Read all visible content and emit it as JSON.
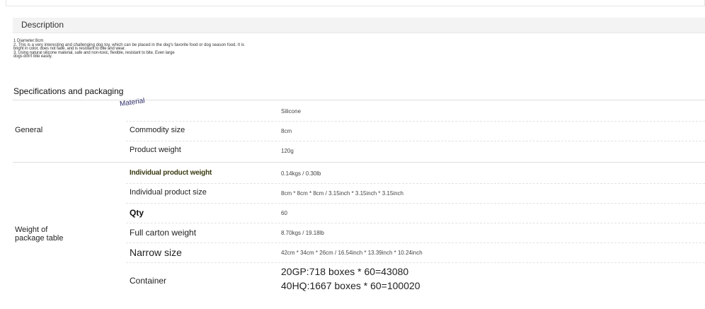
{
  "description": {
    "header": "Description",
    "lines": [
      "1 Diameter:8cm",
      "2. This is a very interesting and challenging dog toy, which can be placed in the dog's favorite food or dog season food. It is",
      "bright in color, does not fade, and is resistant to bite and wear.",
      "3. Using natural silicone material, safe and non-toxic, flexible, resistant to bite. Even large",
      "dogs don't bite easily."
    ]
  },
  "specifications": {
    "title": "Specifications and packaging",
    "general": {
      "label": "General",
      "rows": [
        {
          "key": "Material",
          "value": "Silicone"
        },
        {
          "key": "Commodity size",
          "value": "8cm"
        },
        {
          "key": "Product weight",
          "value": "120g"
        }
      ]
    },
    "package": {
      "label_line1": "Weight of",
      "label_line2": "package table",
      "rows": [
        {
          "key": "Individual product weight",
          "value": "0.14kgs / 0.30lb"
        },
        {
          "key": "Individual product size",
          "value": "8cm * 8cm * 8cm / 3.15inch * 3.15inch * 3.15inch"
        },
        {
          "key": "Qty",
          "value": "60"
        },
        {
          "key": "Full carton weight",
          "value": "8.70kgs / 19.18lb"
        },
        {
          "key": "Narrow size",
          "value": "42cm * 34cm * 26cm / 16.54inch * 13.39inch * 10.24inch"
        },
        {
          "key": "Container",
          "value_line1": "20GP:718 boxes * 60=43080",
          "value_line2": "40HQ:1667 boxes * 60=100020"
        }
      ]
    }
  }
}
